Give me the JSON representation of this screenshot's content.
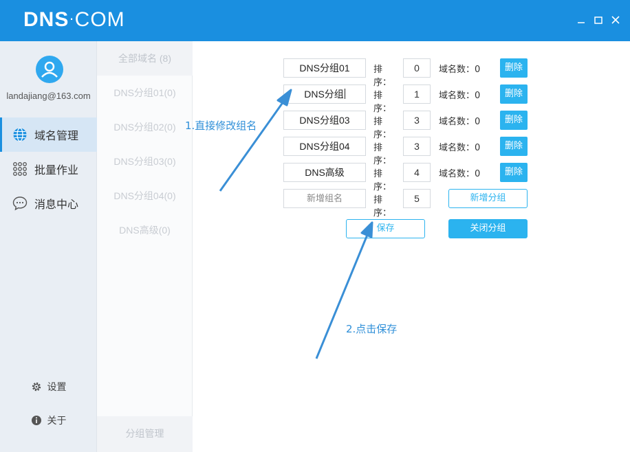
{
  "app": {
    "logo_bold": "DNS",
    "logo_thin": "COM",
    "window_controls": [
      "minimize-icon",
      "maximize-icon",
      "close-icon"
    ]
  },
  "user": {
    "email": "landajiang@163.com"
  },
  "nav": [
    {
      "label": "域名管理",
      "icon": "globe-icon",
      "active": true
    },
    {
      "label": "批量作业",
      "icon": "grid-dots-icon",
      "active": false
    },
    {
      "label": "消息中心",
      "icon": "chat-icon",
      "active": false
    }
  ],
  "bottom_nav": [
    {
      "label": "设置",
      "icon": "gear-icon"
    },
    {
      "label": "关于",
      "icon": "info-icon"
    }
  ],
  "groups": {
    "items": [
      "全部域名 (8)",
      "DNS分组01(0)",
      "DNS分组02(0)",
      "DNS分组03(0)",
      "DNS分组04(0)",
      "DNS高级(0)"
    ],
    "footer": "分组管理"
  },
  "editor": {
    "order_label": "排序：",
    "count_label": "域名数：",
    "delete_label": "删除",
    "rows": [
      {
        "name": "DNS分组01",
        "order": "0",
        "count": "0"
      },
      {
        "name": "DNS分组",
        "order": "1",
        "count": "0"
      },
      {
        "name": "DNS分组03",
        "order": "3",
        "count": "0"
      },
      {
        "name": "DNS分组04",
        "order": "3",
        "count": "0"
      },
      {
        "name": "DNS高级",
        "order": "4",
        "count": "0"
      }
    ],
    "new_row": {
      "placeholder": "新增组名",
      "order": "5"
    },
    "add_group_label": "新增分组",
    "save_label": "保存",
    "close_label": "关闭分组"
  },
  "annotations": {
    "step1": "1.直接修改组名",
    "step2": "2.点击保存"
  },
  "colors": {
    "titlebar": "#1a8fe0",
    "accent": "#2bb3ef",
    "annotation": "#2f8fd8"
  }
}
